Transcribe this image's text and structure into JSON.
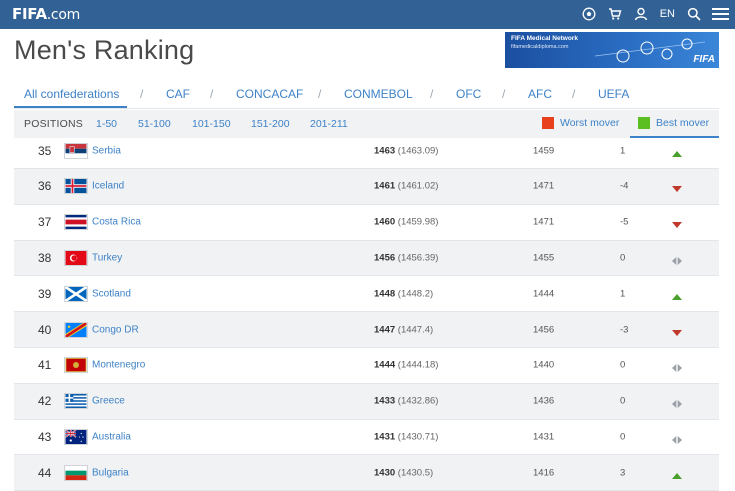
{
  "header": {
    "logo_main": "FIFA",
    "logo_suffix": ".com",
    "lang": "EN"
  },
  "page_title": "Men's Ranking",
  "banner": {
    "line1": "FIFA Medical Network",
    "line2": "fifamedicaldiploma.com",
    "brand": "FIFA"
  },
  "confederations": [
    {
      "label": "All confederations",
      "active": true
    },
    {
      "label": "CAF"
    },
    {
      "label": "CONCACAF"
    },
    {
      "label": "CONMEBOL"
    },
    {
      "label": "OFC"
    },
    {
      "label": "AFC"
    },
    {
      "label": "UEFA"
    }
  ],
  "separator": "/",
  "positions": {
    "label": "POSITIONS",
    "ranges": [
      "1-50",
      "51-100",
      "101-150",
      "151-200",
      "201-211"
    ]
  },
  "legend": {
    "worst": "Worst mover",
    "best": "Best mover",
    "worst_color": "#e8401c",
    "best_color": "#5bbf21"
  },
  "rows": [
    {
      "rank": "35",
      "team": "Serbia",
      "points": "1463",
      "exact": "(1463.09)",
      "prev": "1459",
      "move": "1",
      "trend": "up",
      "flag": "serbia"
    },
    {
      "rank": "36",
      "team": "Iceland",
      "points": "1461",
      "exact": "(1461.02)",
      "prev": "1471",
      "move": "-4",
      "trend": "down",
      "flag": "iceland"
    },
    {
      "rank": "37",
      "team": "Costa Rica",
      "points": "1460",
      "exact": "(1459.98)",
      "prev": "1471",
      "move": "-5",
      "trend": "down",
      "flag": "costa-rica"
    },
    {
      "rank": "38",
      "team": "Turkey",
      "points": "1456",
      "exact": "(1456.39)",
      "prev": "1455",
      "move": "0",
      "trend": "same",
      "flag": "turkey"
    },
    {
      "rank": "39",
      "team": "Scotland",
      "points": "1448",
      "exact": "(1448.2)",
      "prev": "1444",
      "move": "1",
      "trend": "up",
      "flag": "scotland"
    },
    {
      "rank": "40",
      "team": "Congo DR",
      "points": "1447",
      "exact": "(1447.4)",
      "prev": "1456",
      "move": "-3",
      "trend": "down",
      "flag": "congo-dr"
    },
    {
      "rank": "41",
      "team": "Montenegro",
      "points": "1444",
      "exact": "(1444.18)",
      "prev": "1440",
      "move": "0",
      "trend": "same",
      "flag": "montenegro"
    },
    {
      "rank": "42",
      "team": "Greece",
      "points": "1433",
      "exact": "(1432.86)",
      "prev": "1436",
      "move": "0",
      "trend": "same",
      "flag": "greece"
    },
    {
      "rank": "43",
      "team": "Australia",
      "points": "1431",
      "exact": "(1430.71)",
      "prev": "1431",
      "move": "0",
      "trend": "same",
      "flag": "australia"
    },
    {
      "rank": "44",
      "team": "Bulgaria",
      "points": "1430",
      "exact": "(1430.5)",
      "prev": "1416",
      "move": "3",
      "trend": "up",
      "flag": "bulgaria"
    }
  ],
  "colors": {
    "header_bg": "#326295",
    "link": "#3e82c7",
    "up": "#4aa02c",
    "down": "#c0392b",
    "same": "#9aa0a6"
  },
  "icons": [
    "ball-icon",
    "cart-icon",
    "user-icon",
    "search-icon",
    "menu-icon"
  ]
}
